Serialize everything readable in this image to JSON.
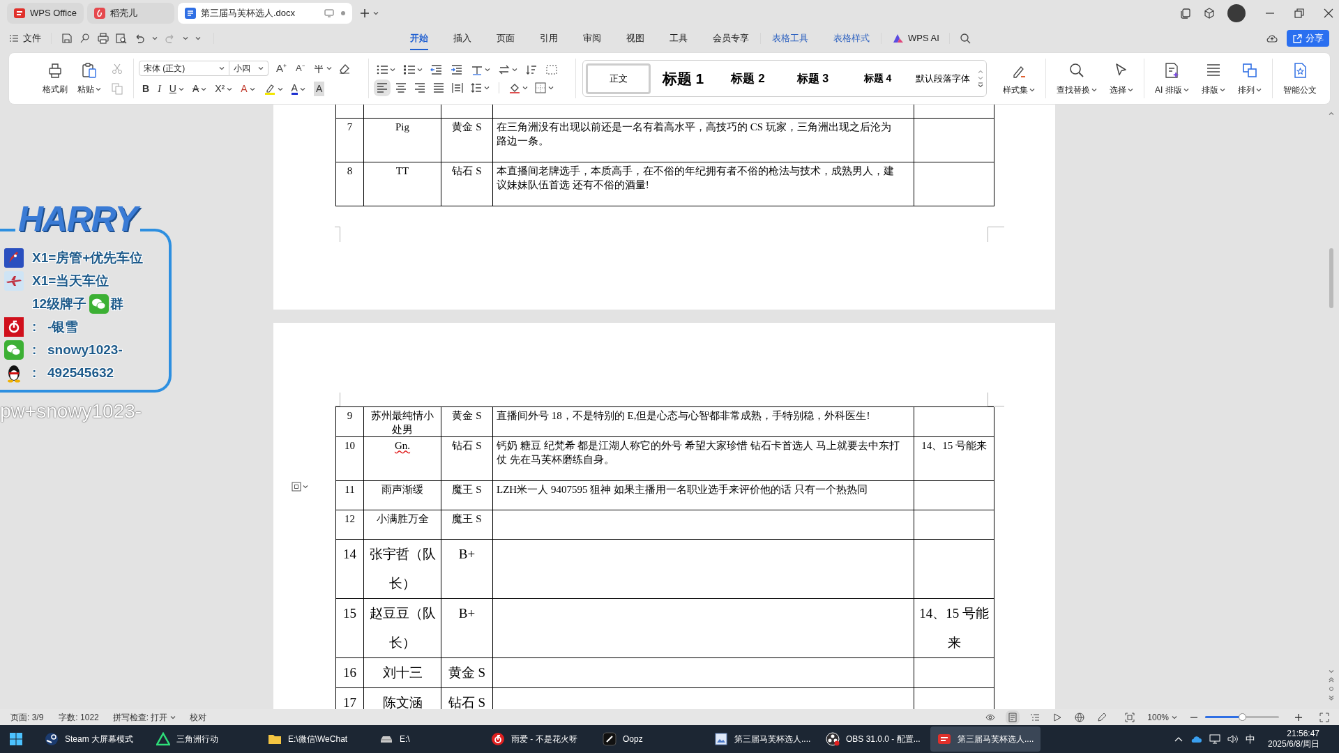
{
  "title_bar": {
    "tabs": [
      {
        "label": "WPS Office",
        "kind": "wps",
        "selected": false
      },
      {
        "label": "稻壳儿",
        "kind": "docer",
        "selected": false
      },
      {
        "label": "第三届马芙杯选人.docx",
        "kind": "doc",
        "selected": true
      }
    ]
  },
  "menu": {
    "file": "文件",
    "tabs": [
      {
        "label": "开始",
        "kind": "plain",
        "selected": true
      },
      {
        "label": "插入",
        "kind": "plain",
        "selected": false
      },
      {
        "label": "页面",
        "kind": "plain",
        "selected": false
      },
      {
        "label": "引用",
        "kind": "plain",
        "selected": false
      },
      {
        "label": "审阅",
        "kind": "plain",
        "selected": false
      },
      {
        "label": "视图",
        "kind": "plain",
        "selected": false
      },
      {
        "label": "工具",
        "kind": "plain",
        "selected": false
      },
      {
        "label": "会员专享",
        "kind": "plain",
        "selected": false
      },
      {
        "label": "表格工具",
        "kind": "context",
        "selected": false
      },
      {
        "label": "表格样式",
        "kind": "context",
        "selected": false
      },
      {
        "label": "WPS AI",
        "kind": "ai",
        "selected": false
      }
    ],
    "share": "分享"
  },
  "ribbon": {
    "clipboard": [
      {
        "label": "格式刷",
        "kind": "brush"
      },
      {
        "label": "粘贴",
        "kind": "paste"
      }
    ],
    "font_name": "宋体 (正文)",
    "font_size": "小四",
    "size_keys": [
      {
        "label": "A⁺",
        "kind": "grow"
      },
      {
        "label": "A⁻",
        "kind": "shrink"
      }
    ],
    "format_keys": [
      {
        "label": "B",
        "kind": "bold"
      },
      {
        "label": "I",
        "kind": "italic"
      },
      {
        "label": "U",
        "kind": "underline"
      },
      {
        "label": "A",
        "kind": "strike"
      },
      {
        "label": "X²",
        "kind": "super"
      },
      {
        "label": "A",
        "kind": "effect"
      },
      {
        "label": "A",
        "kind": "color"
      },
      {
        "label": "A",
        "kind": "shade"
      }
    ],
    "alignments": [
      {
        "kind": "left",
        "selected": true
      },
      {
        "kind": "center",
        "selected": false
      },
      {
        "kind": "right",
        "selected": false
      },
      {
        "kind": "justify",
        "selected": false
      },
      {
        "kind": "distribute",
        "selected": false
      }
    ],
    "styles": [
      {
        "label": "正文",
        "kind": "body",
        "selected": true
      },
      {
        "label": "标题 1",
        "kind": "h1",
        "selected": false
      },
      {
        "label": "标题 2",
        "kind": "h2",
        "selected": false
      },
      {
        "label": "标题 3",
        "kind": "h3",
        "selected": false
      },
      {
        "label": "标题 4",
        "kind": "h4",
        "selected": false
      },
      {
        "label": "默认段落字体",
        "kind": "default",
        "selected": false
      }
    ],
    "tools": [
      {
        "label": "样式集",
        "kind": "styleset"
      },
      {
        "label": "查找替换",
        "kind": "find"
      },
      {
        "label": "选择",
        "kind": "select"
      },
      {
        "label": "AI 排版",
        "kind": "ai"
      },
      {
        "label": "排版",
        "kind": "layout"
      },
      {
        "label": "排列",
        "kind": "arrange"
      },
      {
        "label": "智能公文",
        "kind": "doc"
      }
    ]
  },
  "page_1_table": {
    "rows": [
      {
        "kind": "stub"
      },
      {
        "kind": "tall",
        "no": "7",
        "name": "Pig",
        "rank": "黄金 S",
        "note": "在三角洲没有出现以前还是一名有着高水平，高技巧的 CS 玩家，三角洲出现之后沦为路边一条。",
        "misspelled": false
      },
      {
        "kind": "tall",
        "no": "8",
        "name": "TT",
        "rank": "钻石 S",
        "note": "本直播间老牌选手，本质高手，在不俗的年纪拥有者不俗的枪法与技术，成熟男人，建议妹妹队伍首选 还有不俗的酒量!",
        "misspelled": false
      }
    ]
  },
  "page_2_table": {
    "rows": [
      {
        "kind": "compact",
        "no": "9",
        "name": "苏州最纯情小处男",
        "rank": "黄金 S",
        "note": "直播间外号 18，不是特别的 E,但是心态与心智都非常成熟，手特别稳，外科医生!",
        "misspelled": false
      },
      {
        "kind": "tall",
        "no": "10",
        "name": "Gn.",
        "rank": "钻石 S",
        "note": "钙奶 糖豆 纪梵希 都是江湖人称它的外号 希望大家珍惜 钻石卡首选人 马上就要去中东打仗 先在马芙杯磨练自身。",
        "remark": "14、15 号能来",
        "misspelled": true
      },
      {
        "kind": "normal",
        "no": "11",
        "name": "雨声渐缓",
        "rank": "魔王 S",
        "note": "LZH米一人 9407595 狙神 如果主播用一名职业选手来评价他的话 只有一个热热同",
        "misspelled": false
      },
      {
        "kind": "normal",
        "no": "12",
        "name": "小满胜万全",
        "rank": "魔王 S",
        "misspelled": false
      },
      {
        "kind": "large",
        "no": "14",
        "name": "张宇哲（队长）",
        "rank": "B+",
        "misspelled": false
      },
      {
        "kind": "large",
        "no": "15",
        "name": "赵豆豆（队长）",
        "rank": "B+",
        "remark": "14、15 号能来",
        "misspelled": false
      },
      {
        "kind": "large",
        "no": "16",
        "name": "刘十三",
        "rank": "黄金 S",
        "misspelled": false
      },
      {
        "kind": "large",
        "no": "17",
        "name": "陈文涵",
        "rank": "钻石 S",
        "misspelled": false
      }
    ]
  },
  "stream_overlay": {
    "logo": "HARRY",
    "lines": [
      {
        "kind": "rocket",
        "text": "X1=房管+优先车位"
      },
      {
        "kind": "plane",
        "text": "X1=当天车位"
      },
      {
        "kind": "group",
        "text": "12级牌子",
        "after": "群"
      },
      {
        "kind": "netease",
        "sep": ":",
        "text": "-银雪"
      },
      {
        "kind": "wechat",
        "sep": ":",
        "text": "snowy1023-"
      },
      {
        "kind": "qq",
        "sep": ":",
        "text": "492545632"
      }
    ],
    "caption": "pw+snowy1023-"
  },
  "status_bar": {
    "page": "页面: 3/9",
    "words": "字数: 1022",
    "spell": "拼写检查: 打开",
    "proof": "校对",
    "zoom": "100%",
    "zoom_slider": {
      "level": 0.5
    }
  },
  "taskbar": {
    "items": [
      {
        "label": "Steam 大屏幕模式",
        "kind": "steam",
        "selected": false
      },
      {
        "label": "三角洲行动",
        "kind": "delta",
        "selected": false
      },
      {
        "label": "E:\\微信\\WeChat",
        "kind": "folder",
        "selected": false
      },
      {
        "label": "E:\\",
        "kind": "drive",
        "selected": false
      },
      {
        "label": "雨爱 - 不是花火呀",
        "kind": "music",
        "selected": false
      },
      {
        "label": "Oopz",
        "kind": "oopz",
        "selected": false
      },
      {
        "label": "第三届马芙杯选人....",
        "kind": "image",
        "selected": false
      },
      {
        "label": "OBS 31.0.0 - 配置...",
        "kind": "obs",
        "selected": false
      },
      {
        "label": "第三届马芙杯选人....",
        "kind": "wps",
        "selected": true
      }
    ],
    "ime": "中",
    "time": "21:56:47",
    "date": "2025/6/8/周日"
  }
}
